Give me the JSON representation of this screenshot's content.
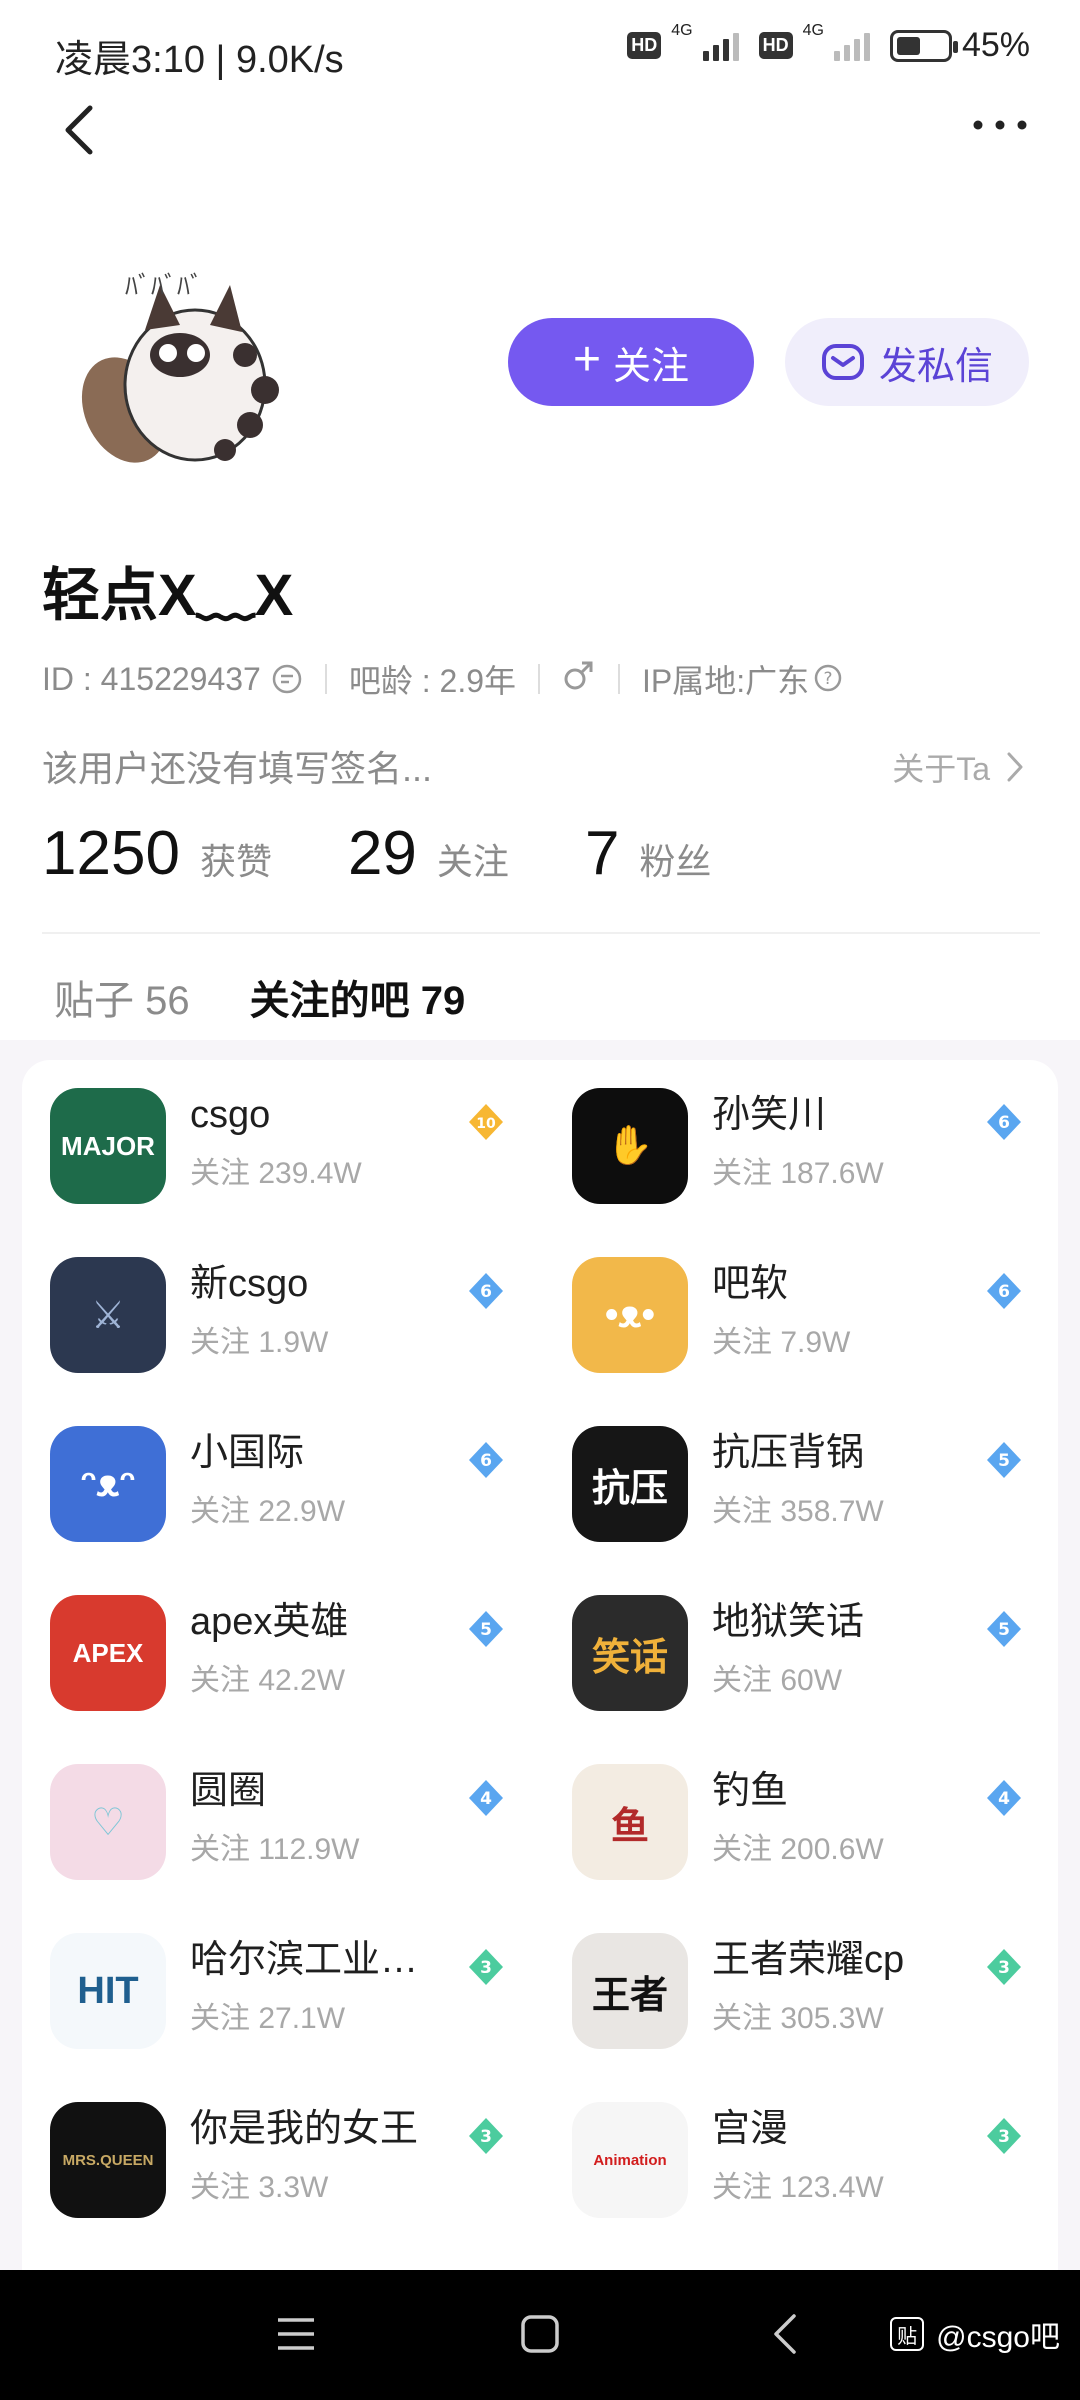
{
  "status_bar": {
    "time": "凌晨3:10 | 9.0K/s",
    "hd_label": "HD",
    "network_label": "4G",
    "battery": "45%",
    "battery_level": 0.45
  },
  "profile": {
    "username": "轻点X﹏X",
    "follow_button": "关注",
    "message_button": "发私信",
    "id": "ID : 415229437",
    "forum_age": "吧龄 : 2.9年",
    "ip_location": "IP属地:广东",
    "signature": "该用户还没有填写签名...",
    "about_link": "关于Ta",
    "stats": [
      {
        "num": "1250",
        "label": "获赞"
      },
      {
        "num": "29",
        "label": "关注"
      },
      {
        "num": "7",
        "label": "粉丝"
      }
    ]
  },
  "tabs": [
    {
      "label": "贴子 56",
      "active": false
    },
    {
      "label": "关注的吧 79",
      "active": true
    }
  ],
  "forums": [
    {
      "name": "csgo",
      "followers": "关注 239.4W",
      "level": "10",
      "level_color": "#f7b733",
      "icon_text": "MAJOR",
      "icon_bg": "#1e6b4a",
      "icon_fg": "#ffffff"
    },
    {
      "name": "孙笑川",
      "followers": "关注 187.6W",
      "level": "6",
      "level_color": "#5aa6f0",
      "icon_text": "✋",
      "icon_bg": "#0d0d0d",
      "icon_fg": "#f2e6dc"
    },
    {
      "name": "新csgo",
      "followers": "关注 1.9W",
      "level": "6",
      "level_color": "#5aa6f0",
      "icon_text": "⚔",
      "icon_bg": "#2c3850",
      "icon_fg": "#9fb4d6"
    },
    {
      "name": "吧软",
      "followers": "关注 7.9W",
      "level": "6",
      "level_color": "#5aa6f0",
      "icon_text": "•ᴥ•",
      "icon_bg": "#f2b84a",
      "icon_fg": "#ffffff"
    },
    {
      "name": "小国际",
      "followers": "关注 22.9W",
      "level": "6",
      "level_color": "#5aa6f0",
      "icon_text": "ᵔᴥᵔ",
      "icon_bg": "#3f6fd6",
      "icon_fg": "#ffffff"
    },
    {
      "name": "抗压背锅",
      "followers": "关注 358.7W",
      "level": "5",
      "level_color": "#5aa6f0",
      "icon_text": "抗压",
      "icon_bg": "#161616",
      "icon_fg": "#ffffff"
    },
    {
      "name": "apex英雄",
      "followers": "关注 42.2W",
      "level": "5",
      "level_color": "#5aa6f0",
      "icon_text": "APEX",
      "icon_bg": "#d83a2e",
      "icon_fg": "#ffffff"
    },
    {
      "name": "地狱笑话",
      "followers": "关注 60W",
      "level": "5",
      "level_color": "#5aa6f0",
      "icon_text": "笑话",
      "icon_bg": "#2b2b2b",
      "icon_fg": "#f0b13a"
    },
    {
      "name": "圆圈",
      "followers": "关注 112.9W",
      "level": "4",
      "level_color": "#5aa6f0",
      "icon_text": "♡",
      "icon_bg": "#f4dbe6",
      "icon_fg": "#7ec6d6"
    },
    {
      "name": "钓鱼",
      "followers": "关注 200.6W",
      "level": "4",
      "level_color": "#5aa6f0",
      "icon_text": "鱼",
      "icon_bg": "#f3ece2",
      "icon_fg": "#b22a2a"
    },
    {
      "name": "哈尔滨工业大学",
      "followers": "关注 27.1W",
      "level": "3",
      "level_color": "#4ccc9e",
      "icon_text": "HIT",
      "icon_bg": "#f4f8fb",
      "icon_fg": "#1f5f8f"
    },
    {
      "name": "王者荣耀cp",
      "followers": "关注 305.3W",
      "level": "3",
      "level_color": "#4ccc9e",
      "icon_text": "王者",
      "icon_bg": "#e9e6e3",
      "icon_fg": "#111111"
    },
    {
      "name": "你是我的女王",
      "followers": "关注 3.3W",
      "level": "3",
      "level_color": "#4ccc9e",
      "icon_text": "MRS.QUEEN",
      "icon_bg": "#111111",
      "icon_fg": "#c8a964"
    },
    {
      "name": "宫漫",
      "followers": "关注 123.4W",
      "level": "3",
      "level_color": "#4ccc9e",
      "icon_text": "Animation",
      "icon_bg": "#f6f6f6",
      "icon_fg": "#d21d1d"
    }
  ],
  "watermark": {
    "logo": "贴",
    "text": "@csgo吧"
  },
  "colors": {
    "accent": "#7559f0",
    "accent_light": "#f0eefb"
  }
}
